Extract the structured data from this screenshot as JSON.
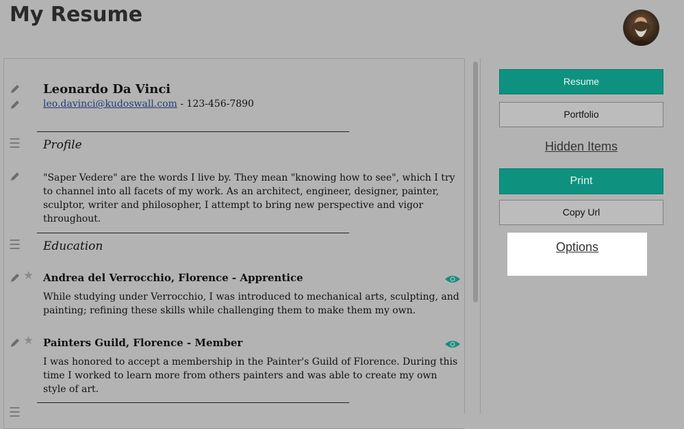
{
  "header": {
    "title": "My Resume"
  },
  "resume": {
    "name": "Leonardo Da Vinci",
    "email": "leo.davinci@kudoswall.com",
    "separator": " - ",
    "phone": "123-456-7890",
    "profile": {
      "title": "Profile",
      "text": "\"Saper Vedere\" are the words I live by. They mean \"knowing how to see\", which I try to channel into all facets of my work. As an architect, engineer, designer, painter, sculptor, writer and philosopher, I attempt to bring new perspective and vigor throughout."
    },
    "education": {
      "title": "Education",
      "entries": [
        {
          "title": "Andrea del Verrocchio, Florence - Apprentice",
          "description": "While studying under Verrocchio, I was introduced to mechanical arts, sculpting, and painting; refining these skills while challenging them to make them my own."
        },
        {
          "title": "Painters Guild, Florence - Member",
          "description": "I was honored to accept a membership in the Painter's Guild of Florence. During this time I worked to learn more from others painters and was able to create my own style of art."
        }
      ]
    }
  },
  "sidebar": {
    "resume_button": "Resume",
    "portfolio_button": "Portfolio",
    "hidden_items_link": "Hidden Items",
    "print_button": "Print",
    "copy_url_button": "Copy Url",
    "options_link": "Options"
  },
  "icons": {
    "edit": "pencil-icon",
    "favorite": "star-icon",
    "reorder": "drag-handle-icon",
    "visibility": "eye-icon"
  },
  "colors": {
    "accent": "#0e927f",
    "background": "#b3b3b3"
  }
}
